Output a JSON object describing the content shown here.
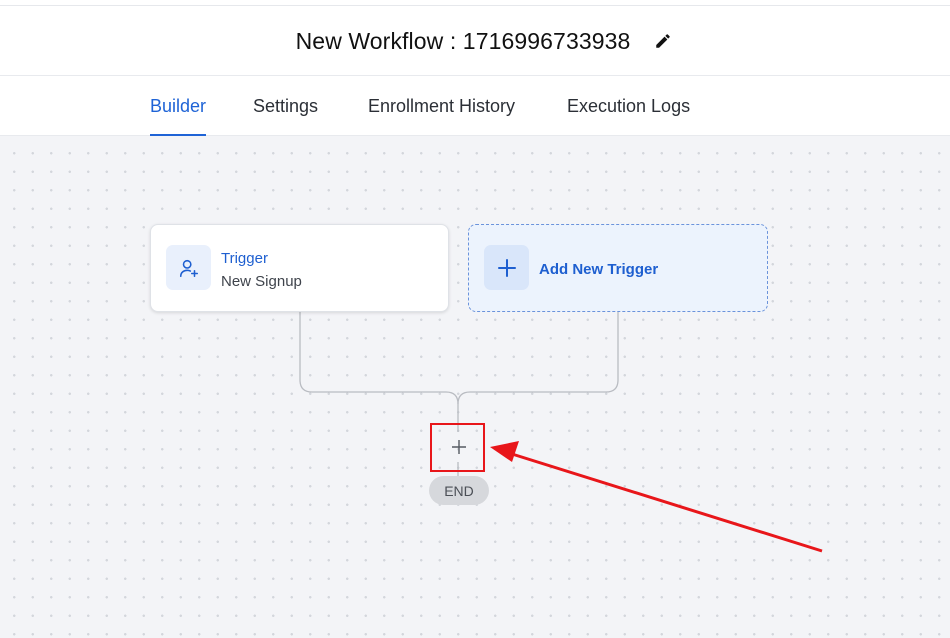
{
  "header": {
    "title": "New Workflow : 1716996733938",
    "edit_icon": "pencil-icon"
  },
  "tabs": [
    {
      "label": "Builder",
      "active": true
    },
    {
      "label": "Settings",
      "active": false
    },
    {
      "label": "Enrollment History",
      "active": false
    },
    {
      "label": "Execution Logs",
      "active": false
    }
  ],
  "canvas": {
    "trigger_card": {
      "icon": "user-plus-icon",
      "label": "Trigger",
      "subtitle": "New Signup"
    },
    "add_trigger_card": {
      "icon": "plus-icon",
      "label": "Add New Trigger"
    },
    "add_step": {
      "icon": "plus-icon",
      "symbol": "+"
    },
    "end_node": {
      "label": "END"
    },
    "annotation": {
      "color": "#e8161a",
      "type": "red-box-and-arrow"
    }
  },
  "colors": {
    "accent": "#1e63d6",
    "canvas_bg": "#f3f4f7",
    "annotation_red": "#e8161a"
  }
}
